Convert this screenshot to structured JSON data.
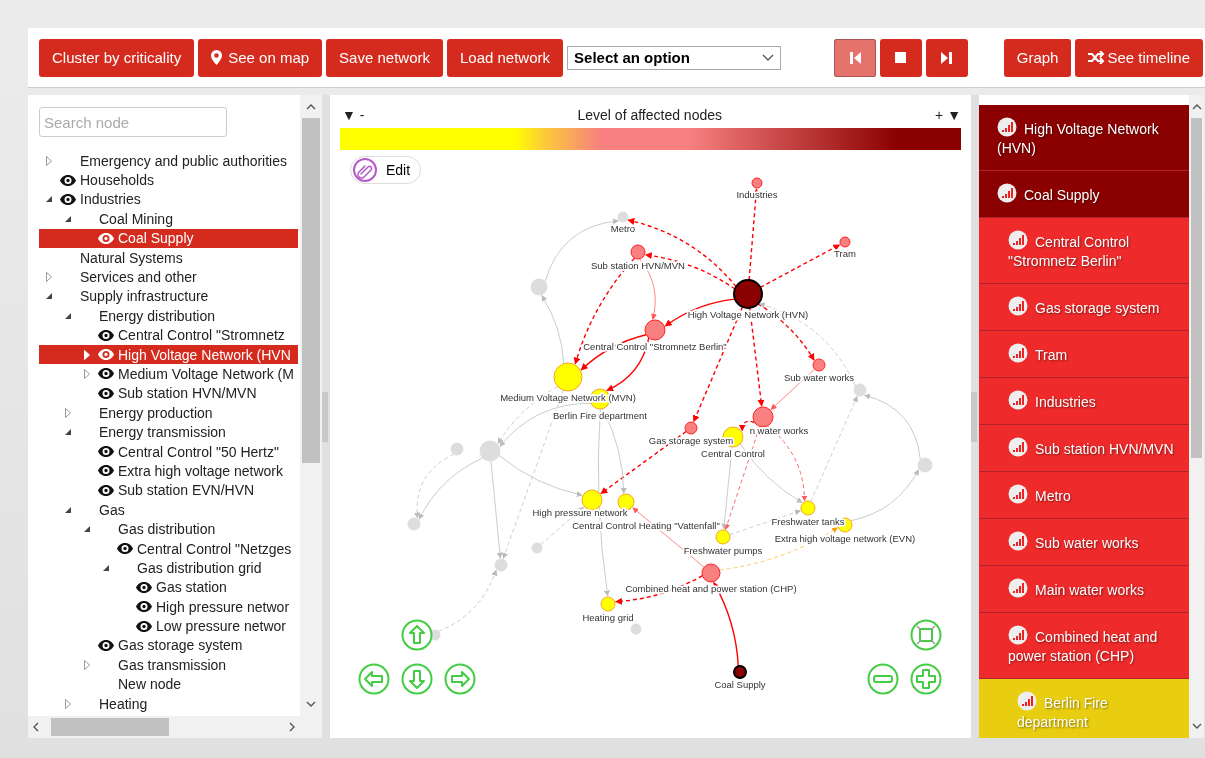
{
  "toolbar": {
    "buttons": [
      {
        "label": "Cluster by criticality",
        "kind": "text"
      },
      {
        "label": "See on map",
        "kind": "map"
      },
      {
        "label": "Save network",
        "kind": "text"
      },
      {
        "label": "Load network",
        "kind": "text"
      }
    ],
    "select": {
      "value": "Select an option"
    },
    "player": [
      {
        "kind": "prev",
        "disabled": true
      },
      {
        "kind": "stop",
        "disabled": false
      },
      {
        "kind": "next",
        "disabled": false
      }
    ],
    "view_buttons": [
      {
        "label": "Graph",
        "kind": "text"
      },
      {
        "label": "See timeline",
        "kind": "timeline"
      }
    ]
  },
  "tree": {
    "search": {
      "placeholder": "Search node"
    },
    "items": [
      {
        "label": "Emergency and public authorities",
        "eye": false,
        "selected": false,
        "expanded": false
      },
      {
        "label": "Households",
        "eye": true,
        "selected": false
      },
      {
        "label": "Industries",
        "eye": true,
        "selected": false,
        "expanded": true,
        "children": [
          {
            "label": "Coal Mining",
            "eye": false,
            "selected": false,
            "expanded": true,
            "children": [
              {
                "label": "Coal Supply",
                "eye": true,
                "selected": true
              }
            ]
          }
        ]
      },
      {
        "label": "Natural Systems",
        "eye": false,
        "selected": false
      },
      {
        "label": "Services and other",
        "eye": false,
        "selected": false,
        "expanded": false
      },
      {
        "label": "Supply infrastructure",
        "eye": false,
        "selected": false,
        "expanded": true,
        "children": [
          {
            "label": "Energy distribution",
            "eye": false,
            "selected": false,
            "expanded": true,
            "children": [
              {
                "label": "Central Control \"Stromnetz",
                "eye": true,
                "selected": false
              },
              {
                "label": "High Voltage Network (HVN",
                "eye": true,
                "selected": true,
                "expanded": false
              },
              {
                "label": "Medium Voltage Network (M",
                "eye": true,
                "selected": false,
                "expanded": false
              },
              {
                "label": "Sub station HVN/MVN",
                "eye": true,
                "selected": false
              }
            ]
          },
          {
            "label": "Energy production",
            "eye": false,
            "selected": false,
            "expanded": false
          },
          {
            "label": "Energy transmission",
            "eye": false,
            "selected": false,
            "expanded": true,
            "children": [
              {
                "label": "Central Control \"50 Hertz\"",
                "eye": true,
                "selected": false
              },
              {
                "label": "Extra high voltage network",
                "eye": true,
                "selected": false
              },
              {
                "label": "Sub station EVN/HVN",
                "eye": true,
                "selected": false
              }
            ]
          },
          {
            "label": "Gas",
            "eye": false,
            "selected": false,
            "expanded": true,
            "children": [
              {
                "label": "Gas distribution",
                "eye": false,
                "selected": false,
                "expanded": true,
                "children": [
                  {
                    "label": "Central Control \"Netzges",
                    "eye": true,
                    "selected": false
                  },
                  {
                    "label": "Gas distribution grid",
                    "eye": false,
                    "selected": false,
                    "expanded": true,
                    "children": [
                      {
                        "label": "Gas station",
                        "eye": true,
                        "selected": false
                      },
                      {
                        "label": "High pressure networ",
                        "eye": true,
                        "selected": false
                      },
                      {
                        "label": "Low pressure networ",
                        "eye": true,
                        "selected": false
                      }
                    ]
                  }
                ]
              },
              {
                "label": "Gas storage system",
                "eye": true,
                "selected": false
              },
              {
                "label": "Gas transmission",
                "eye": false,
                "selected": false,
                "expanded": false
              },
              {
                "label": "New node",
                "eye": false,
                "selected": false
              }
            ]
          },
          {
            "label": "Heating",
            "eye": false,
            "selected": false,
            "expanded": false
          }
        ]
      }
    ]
  },
  "legend": {
    "less": "▼ -",
    "title": "Level of affected nodes",
    "more": "+ ▼"
  },
  "edit_button": {
    "label": "Edit"
  },
  "graph": {
    "nodes": [
      {
        "label": "Industries",
        "color": "#f88080",
        "source": false
      },
      {
        "label": "Tram",
        "color": "#f88080",
        "source": false
      },
      {
        "label": "Metro",
        "color": "#dddddd",
        "source": false
      },
      {
        "label": "Sub station HVN/MVN",
        "color": "#f88080",
        "source": false
      },
      {
        "label": "High Voltage Network (HVN)",
        "color": "#8b0000",
        "source": true
      },
      {
        "label": "Central Control \"Stromnetz Berlin\"",
        "color": "#f88080",
        "source": false
      },
      {
        "label": "Sub water works",
        "color": "#f88080",
        "source": false
      },
      {
        "label": "n water works",
        "color": "#f88080",
        "source": false
      },
      {
        "label": "Gas storage system",
        "color": "#f88080",
        "source": false
      },
      {
        "label": "Central Control",
        "color": "#ffff00",
        "source": false
      },
      {
        "label": "Medium Voltage Network (MVN)",
        "color": "#ffff00",
        "source": false
      },
      {
        "label": "Berlin Fire department",
        "color": "#ffff00",
        "source": false
      },
      {
        "label": "High pressure network",
        "color": "#ffff00",
        "source": false
      },
      {
        "label": "Central Control Heating \"Vattenfall\"",
        "color": "#ffff00",
        "source": false
      },
      {
        "label": "Freshwater tanks",
        "color": "#ffff00",
        "source": false
      },
      {
        "label": "Extra high voltage network (EVN)",
        "color": "#ffff00",
        "source": false
      },
      {
        "label": "Freshwater pumps",
        "color": "#ffff00",
        "source": false
      },
      {
        "label": "Combined heat and power station (CHP)",
        "color": "#f88080",
        "source": false
      },
      {
        "label": "Heating grid",
        "color": "#ffff00",
        "source": false
      },
      {
        "label": "Coal Supply",
        "color": "#8b0000",
        "source": true
      },
      {
        "color": "#dddddd",
        "source": false
      },
      {
        "color": "#dddddd",
        "source": false
      },
      {
        "color": "#dddddd",
        "source": false
      },
      {
        "color": "#dddddd",
        "source": false
      },
      {
        "color": "#dddddd",
        "source": false
      },
      {
        "color": "#dddddd",
        "source": false
      },
      {
        "color": "#dddddd",
        "source": false
      },
      {
        "color": "#dddddd",
        "source": false
      },
      {
        "color": "#dddddd",
        "source": false
      },
      {
        "color": "#dddddd",
        "source": false
      }
    ]
  },
  "impact_list": [
    {
      "label": "High Voltage Network (HVN)",
      "color": "#8b0000"
    },
    {
      "label": "Coal Supply",
      "color": "#8b0000"
    },
    {
      "label": "Central Control \"Stromnetz Berlin\"",
      "color": "#ee2a2a"
    },
    {
      "label": "Gas storage system",
      "color": "#ee2a2a"
    },
    {
      "label": "Tram",
      "color": "#ee2a2a"
    },
    {
      "label": "Industries",
      "color": "#ee2a2a"
    },
    {
      "label": "Sub station HVN/MVN",
      "color": "#ee2a2a"
    },
    {
      "label": "Metro",
      "color": "#ee2a2a"
    },
    {
      "label": "Sub water works",
      "color": "#ee2a2a"
    },
    {
      "label": "Main water works",
      "color": "#ee2a2a"
    },
    {
      "label": "Combined heat and power station (CHP)",
      "color": "#ee2a2a"
    },
    {
      "label": "Berlin Fire department",
      "color": "#e8cd10"
    }
  ]
}
